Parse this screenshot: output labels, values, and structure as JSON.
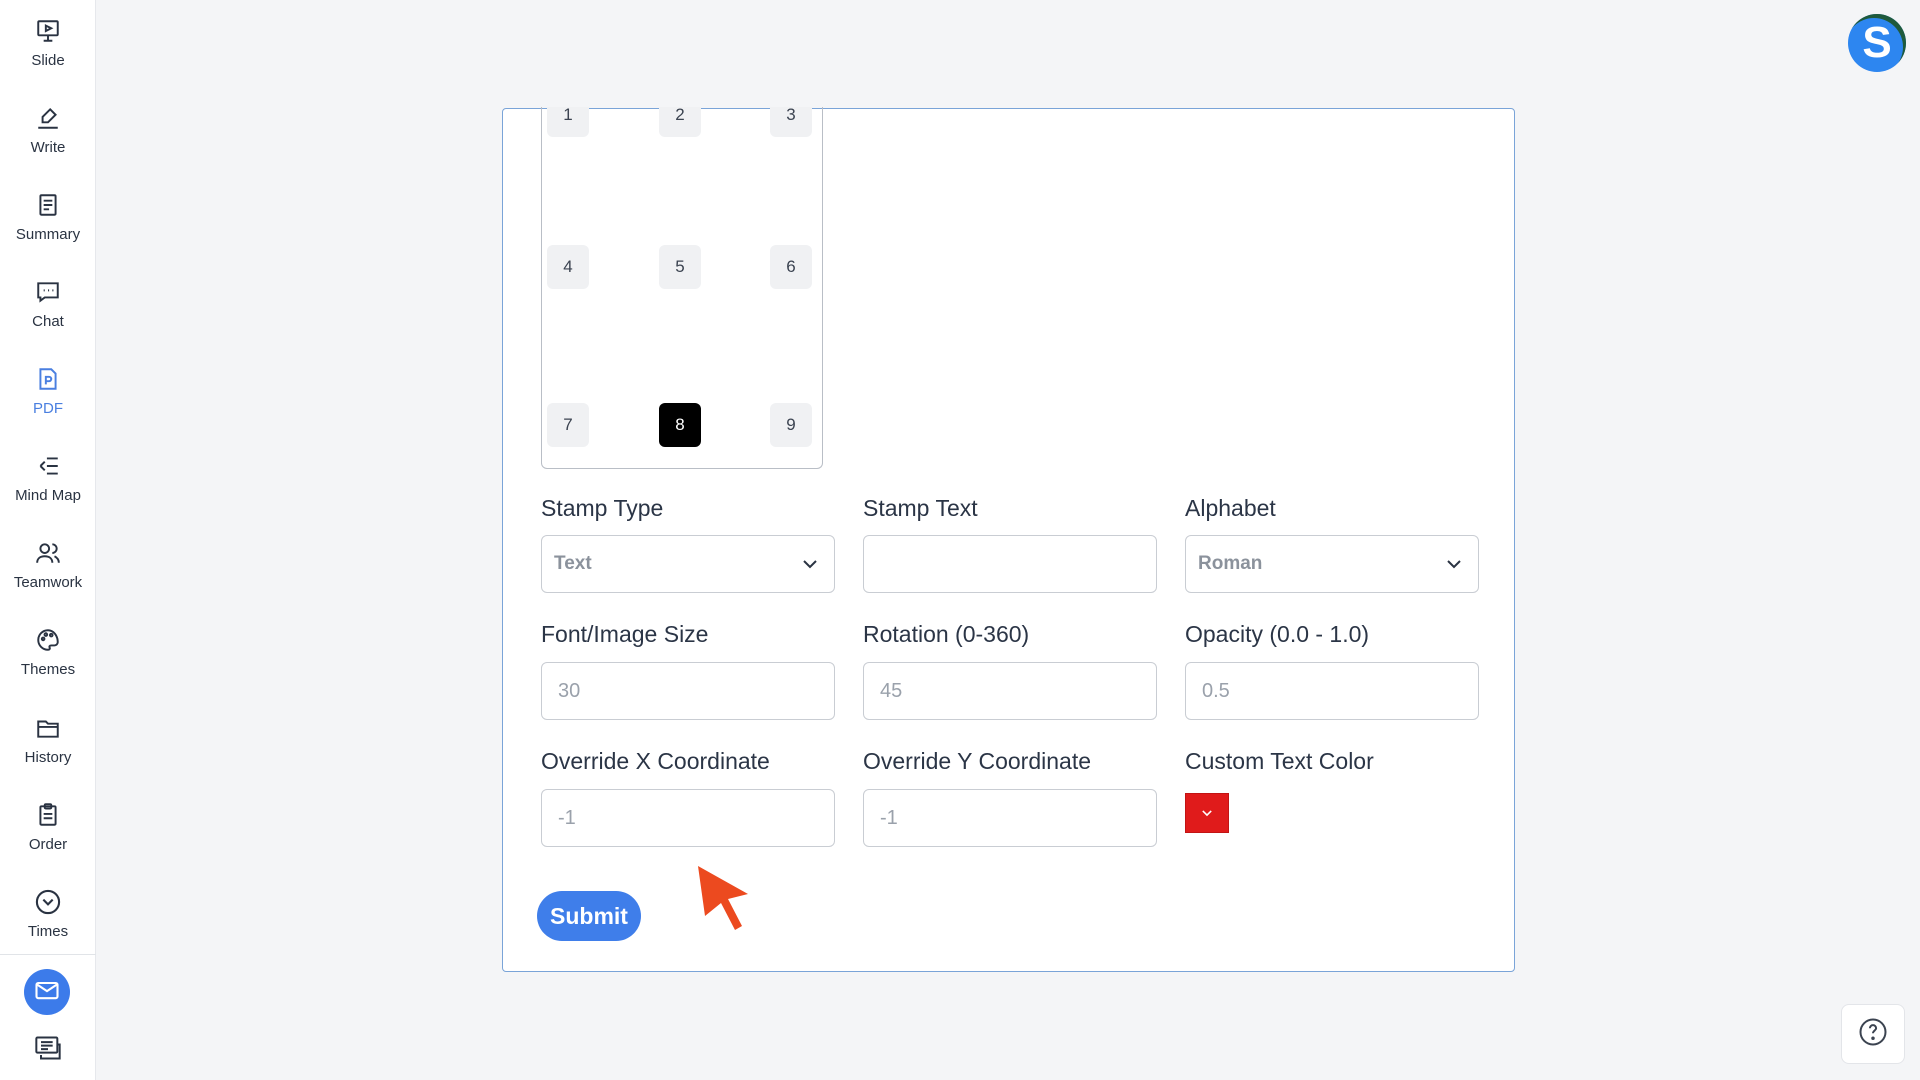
{
  "sidebar": {
    "items": [
      {
        "label": "Slide",
        "icon": "presentation-icon"
      },
      {
        "label": "Write",
        "icon": "pen-icon"
      },
      {
        "label": "Summary",
        "icon": "document-icon"
      },
      {
        "label": "Chat",
        "icon": "chat-icon"
      },
      {
        "label": "PDF",
        "icon": "pdf-icon",
        "active": true
      },
      {
        "label": "Mind Map",
        "icon": "mind-map-icon"
      },
      {
        "label": "Teamwork",
        "icon": "team-icon"
      },
      {
        "label": "Themes",
        "icon": "palette-icon"
      },
      {
        "label": "History",
        "icon": "folder-icon"
      },
      {
        "label": "Order",
        "icon": "clipboard-icon"
      },
      {
        "label": "Times",
        "icon": "chevron-circle-icon"
      }
    ],
    "bottom_icons": [
      "mail-icon",
      "slides-icon"
    ]
  },
  "avatar": {
    "letter": "S"
  },
  "position_grid": {
    "cells": [
      "1",
      "2",
      "3",
      "4",
      "5",
      "6",
      "7",
      "8",
      "9"
    ],
    "selected": "8"
  },
  "form": {
    "stamp_type": {
      "label": "Stamp Type",
      "value": "Text"
    },
    "stamp_text": {
      "label": "Stamp Text",
      "value": ""
    },
    "alphabet": {
      "label": "Alphabet",
      "value": "Roman"
    },
    "font_size": {
      "label": "Font/Image Size",
      "placeholder": "30"
    },
    "rotation": {
      "label": "Rotation (0-360)",
      "placeholder": "45"
    },
    "opacity": {
      "label": "Opacity (0.0 - 1.0)",
      "placeholder": "0.5"
    },
    "override_x": {
      "label": "Override X Coordinate",
      "placeholder": "-1"
    },
    "override_y": {
      "label": "Override Y Coordinate",
      "placeholder": "-1"
    },
    "text_color": {
      "label": "Custom Text Color",
      "value": "#e01b1b"
    },
    "submit_label": "Submit"
  },
  "colors": {
    "accent": "#3f7eea",
    "active_nav": "#4a7fe0",
    "stamp_color": "#e01b1b"
  }
}
